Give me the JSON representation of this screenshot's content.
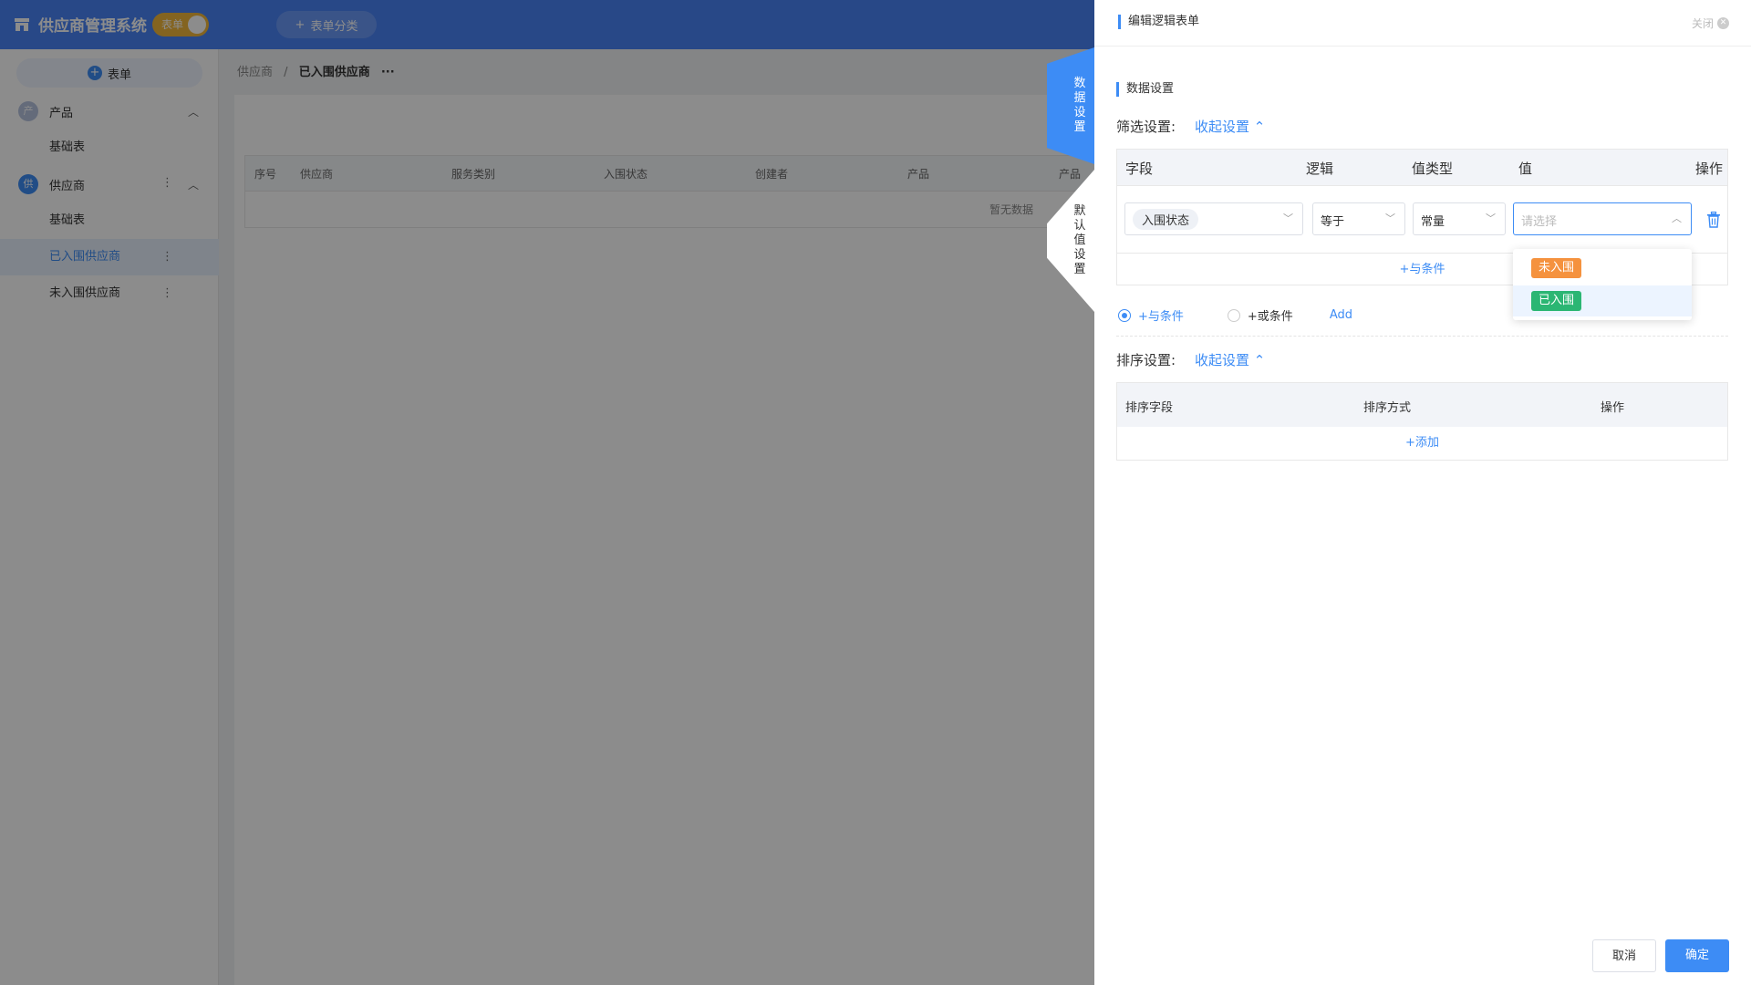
{
  "app": {
    "title": "供应商管理系统",
    "mode_toggle": "表单",
    "category_button": "表单分类"
  },
  "sidebar": {
    "add_button": "表单",
    "groups": [
      {
        "icon_char": "产",
        "label": "产品",
        "items": [
          "基础表"
        ]
      },
      {
        "icon_char": "供",
        "label": "供应商",
        "items": [
          "基础表",
          "已入围供应商",
          "未入围供应商"
        ]
      }
    ]
  },
  "breadcrumb": {
    "parent": "供应商",
    "separator": "/",
    "current": "已入围供应商",
    "more": "···"
  },
  "background_table": {
    "columns": [
      "序号",
      "供应商",
      "服务类别",
      "入围状态",
      "创建者",
      "产品",
      "产品"
    ],
    "empty_text": "暂无数据"
  },
  "drawer": {
    "title": "编辑逻辑表单",
    "close": "关闭",
    "tabs": [
      {
        "label": "数据设置",
        "chars": [
          "数",
          "据",
          "设",
          "置"
        ]
      },
      {
        "label": "默认值设置",
        "chars": [
          "默",
          "认",
          "值",
          "设",
          "置"
        ]
      }
    ],
    "section_title": "数据设置",
    "filter": {
      "label": "筛选设置:",
      "collapse": "收起设置 ⌃",
      "columns": {
        "field": "字段",
        "logic": "逻辑",
        "value_type": "值类型",
        "value": "值",
        "action": "操作"
      },
      "row": {
        "field": "入围状态",
        "logic": "等于",
        "value_type": "常量",
        "value_placeholder": "请选择"
      },
      "add_and": "+与条件",
      "dropdown_options": [
        {
          "label": "未入围",
          "color": "#f5923e"
        },
        {
          "label": "已入围",
          "color": "#2bb673"
        }
      ]
    },
    "conditions": {
      "and": "+与条件",
      "or": "+或条件",
      "add": "Add"
    },
    "sort": {
      "label": "排序设置:",
      "collapse": "收起设置 ⌃",
      "columns": {
        "field": "排序字段",
        "method": "排序方式",
        "action": "操作"
      },
      "add": "+添加"
    },
    "footer": {
      "cancel": "取消",
      "confirm": "确定"
    }
  },
  "colors": {
    "brand": "#4a84f6",
    "accent": "#3d8cf5",
    "warning_tag": "#f5923e",
    "success_tag": "#2bb673"
  }
}
